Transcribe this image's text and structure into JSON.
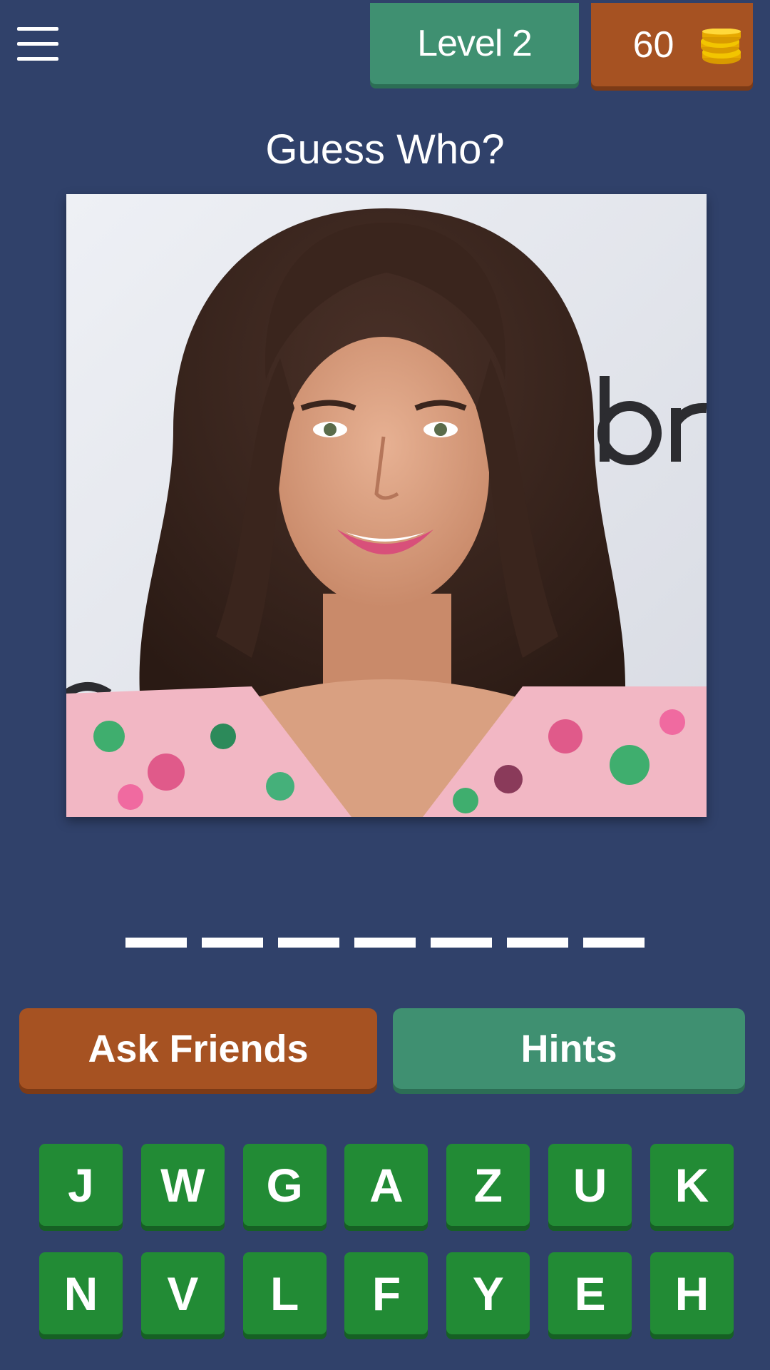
{
  "header": {
    "menu_icon": "hamburger-menu-icon",
    "level_label": "Level 2",
    "coins": "60",
    "coin_icon": "coin-stack-icon"
  },
  "title": "Guess Who?",
  "answer": {
    "slot_count": 7
  },
  "buttons": {
    "ask_friends": "Ask Friends",
    "hints": "Hints"
  },
  "keyboard": {
    "row1": [
      "J",
      "W",
      "G",
      "A",
      "Z",
      "U",
      "K"
    ],
    "row2": [
      "N",
      "V",
      "L",
      "F",
      "Y",
      "E",
      "H"
    ]
  },
  "colors": {
    "background": "#30416a",
    "green_accent": "#3f9071",
    "orange_accent": "#a65222",
    "key_green": "#228b35"
  }
}
